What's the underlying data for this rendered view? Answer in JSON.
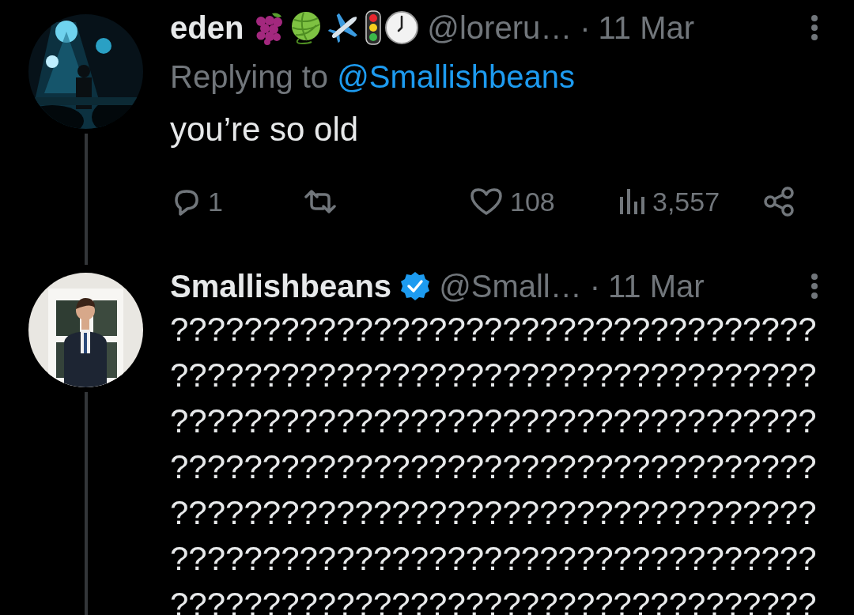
{
  "tweets": [
    {
      "avatar": {
        "kind": "picture"
      },
      "thread_line": true,
      "name": "eden",
      "badges": [
        {
          "kind": "grapes"
        },
        {
          "kind": "yarn"
        },
        {
          "kind": "airplane"
        },
        {
          "kind": "traffic-light"
        },
        {
          "kind": "clock"
        }
      ],
      "handle": "@loreru…",
      "separator": "·",
      "time": "11 Mar",
      "replying_label": "Replying to",
      "replying_to": "@Smallishbeans",
      "text_lines": [
        "you’re so old"
      ],
      "actions": {
        "replies": "1",
        "likes": "108",
        "views": "3,557"
      }
    },
    {
      "avatar": {
        "kind": "picture"
      },
      "thread_line": true,
      "name": "Smallishbeans",
      "badges": [
        {
          "kind": "verified"
        }
      ],
      "handle": "@Small…",
      "separator": "·",
      "time": "11 Mar",
      "text_lines": [
        "???????????????????????????????????",
        "???????????????????????????????????",
        "???????????????????????????????????",
        "???????????????????????????????????",
        "???????????????????????????????????",
        "???????????????????????????????????",
        "???????????????????????????????????"
      ]
    }
  ]
}
